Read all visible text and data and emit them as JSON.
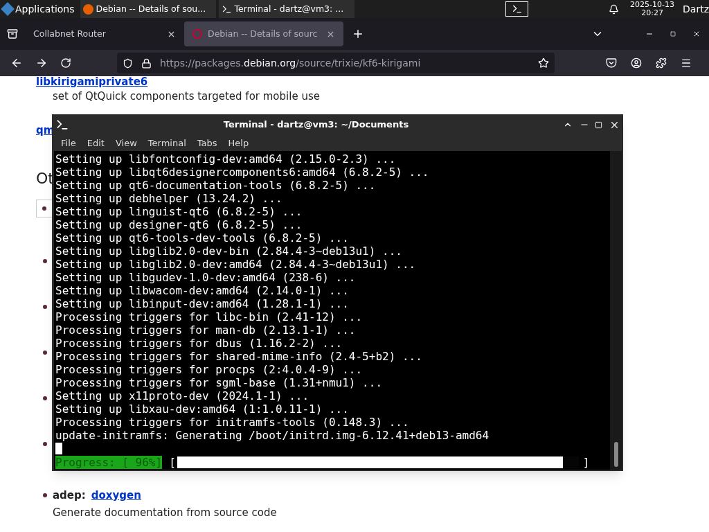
{
  "taskbar": {
    "apps_label": "Applications",
    "windows": [
      {
        "title": "Debian -- Details of sou..."
      },
      {
        "title": "Terminal - dartz@vm3: ..."
      }
    ],
    "date": "2025-10-13",
    "time": "20:27",
    "user": "Dartz"
  },
  "browser": {
    "tabs": [
      {
        "title": "Collabnet Router",
        "selected": false
      },
      {
        "title": "Debian -- Details of sourc",
        "selected": true
      }
    ],
    "url": {
      "prefix": "https://packages.",
      "domain": "debian.org",
      "path": "/source/trixie/kf6-kirigami"
    }
  },
  "page": {
    "top_link": "libkirigamiprivate6",
    "top_description": "set of QtQuick components targeted for mobile use",
    "second_link": "qm",
    "heading": "Ot",
    "dep": {
      "label": "adep:",
      "link": "doxygen",
      "description": "Generate documentation from source code"
    }
  },
  "terminal": {
    "title": "Terminal - dartz@vm3: ~/Documents",
    "menu": [
      "File",
      "Edit",
      "View",
      "Terminal",
      "Tabs",
      "Help"
    ],
    "lines": [
      "Setting up libfontconfig-dev:amd64 (2.15.0-2.3) ...",
      "Setting up libqt6designercomponents6:amd64 (6.8.2-5) ...",
      "Setting up qt6-documentation-tools (6.8.2-5) ...",
      "Setting up debhelper (13.24.2) ...",
      "Setting up linguist-qt6 (6.8.2-5) ...",
      "Setting up designer-qt6 (6.8.2-5) ...",
      "Setting up qt6-tools-dev-tools (6.8.2-5) ...",
      "Setting up libglib2.0-dev-bin (2.84.4-3~deb13u1) ...",
      "Setting up libglib2.0-dev:amd64 (2.84.4-3~deb13u1) ...",
      "Setting up libgudev-1.0-dev:amd64 (238-6) ...",
      "Setting up libwacom-dev:amd64 (2.14.0-1) ...",
      "Setting up libinput-dev:amd64 (1.28.1-1) ...",
      "Processing triggers for libc-bin (2.41-12) ...",
      "Processing triggers for man-db (2.13.1-1) ...",
      "Processing triggers for dbus (1.16.2-2) ...",
      "Processing triggers for shared-mime-info (2.4-5+b2) ...",
      "Processing triggers for procps (2:4.0.4-9) ...",
      "Processing triggers for sgml-base (1.31+nmu1) ...",
      "Setting up x11proto-dev (2024.1-1) ...",
      "Setting up libxau-dev:amd64 (1:1.0.11-1) ...",
      "Processing triggers for initramfs-tools (0.148.3) ...",
      "update-initramfs: Generating /boot/initrd.img-6.12.41+deb13-amd64"
    ],
    "progress": {
      "label": "Progress: [ 96%]",
      "open_bracket": "[",
      "close_bracket": "]",
      "level": 0.96
    }
  }
}
